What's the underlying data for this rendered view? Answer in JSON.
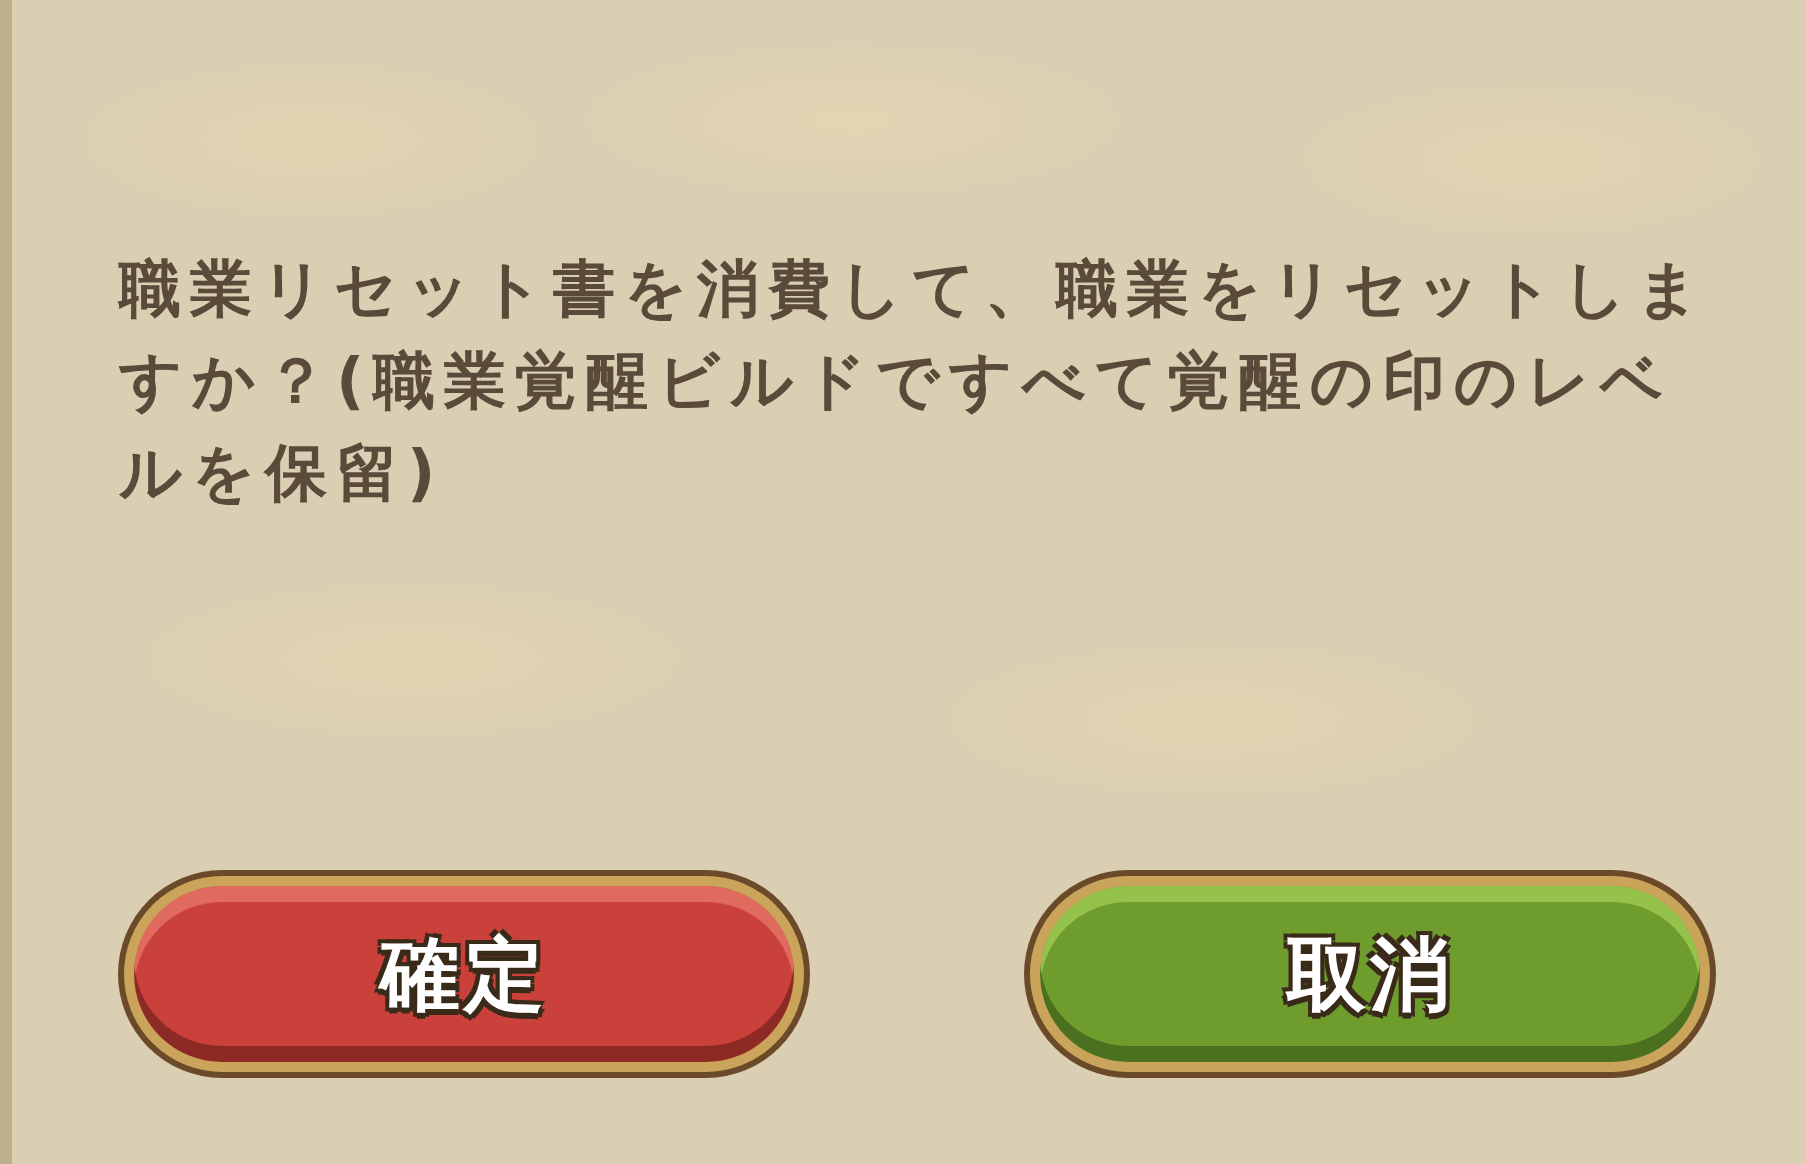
{
  "message": "職業リセット書を消費して、職業をリセットしますか？(職業覚醒ビルドですべて覚醒の印のレベルを保留)",
  "buttons": [
    {
      "label": "確定",
      "kind": "confirm"
    },
    {
      "label": "取消",
      "kind": "cancel"
    }
  ]
}
